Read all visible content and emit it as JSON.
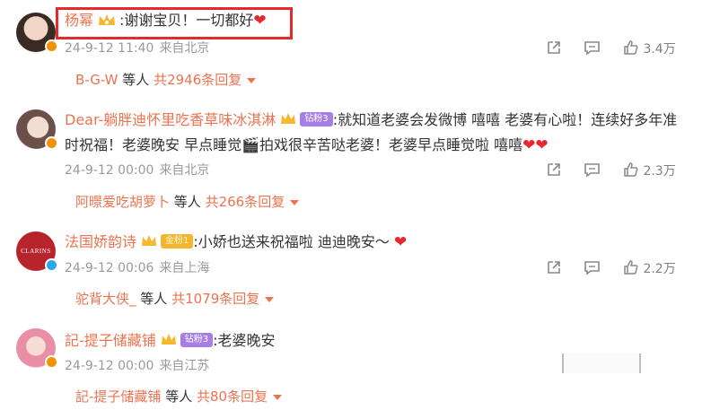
{
  "comments": [
    {
      "username": "杨幂",
      "text": ":谢谢宝贝！一切都好",
      "date": "24-9-12 11:40",
      "location": "来自北京",
      "likes": "3.4万",
      "reply_who": "B-G-W",
      "reply_mid": "等人",
      "reply_count": "共2946条回复",
      "verified_color": "#f39200"
    },
    {
      "username": "Dear-躺胖迪怀里吃香草味冰淇淋",
      "fan_badge": "钻粉3",
      "text_line1": ":就知道老婆会发微博 嘻嘻 老婆有心啦！连续好多年准",
      "text_line2": "时祝福！老婆晚安 早点睡觉🎬拍戏很辛苦哒老婆！老婆早点睡觉啦 嘻嘻",
      "date": "24-9-12 00:00",
      "location": "来自北京",
      "likes": "2.3万",
      "reply_who": "阿暻爱吃胡萝卜",
      "reply_mid": "等人",
      "reply_count": "共266条回复",
      "verified_color": "#f39200"
    },
    {
      "username": "法国娇韵诗",
      "fan_badge": "金粉1",
      "avatar_text": "CLARINS",
      "text": ":小娇也送来祝福啦 迪迪晚安～",
      "date": "24-9-12 00:06",
      "location": "来自上海",
      "likes": "2.2万",
      "reply_who": "驼背大侠_",
      "reply_mid": "等人",
      "reply_count": "共1079条回复",
      "verified_color": "#2aa7e8"
    },
    {
      "username": "記-提子储藏铺",
      "fan_badge": "钻粉3",
      "text": ":老婆晚安",
      "date": "24-9-12 00:00",
      "location": "来自江苏",
      "reply_who": "記-提子储藏铺",
      "reply_mid": "等人",
      "reply_count": "共80条回复",
      "verified_color": "#f39200"
    }
  ],
  "icons": [
    "share-icon",
    "comment-icon",
    "like-icon",
    "heart-emoji",
    "crown-icon"
  ],
  "accent_color": "#eb7350",
  "highlight_color": "#e32b2b"
}
